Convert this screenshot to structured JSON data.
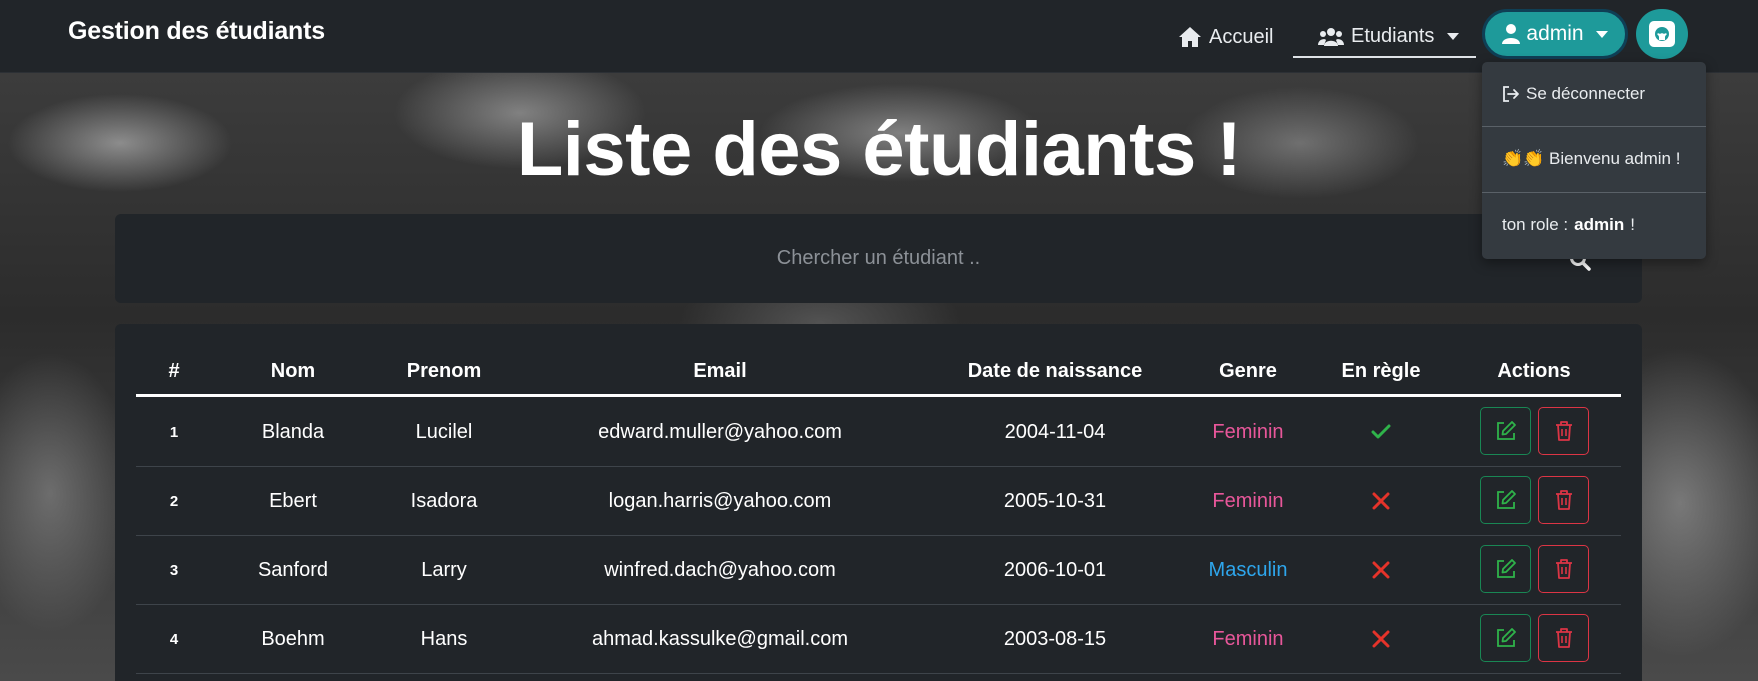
{
  "navbar": {
    "brand": "Gestion des étudiants",
    "home_label": "Accueil",
    "students_label": "Etudiants",
    "user_label": "admin"
  },
  "dropdown": {
    "logout_label": "Se déconnecter",
    "welcome_label": "👏👏 Bienvenu admin !",
    "role_prefix": "ton role :",
    "role_value": "admin",
    "role_suffix": "!"
  },
  "hero": {
    "title": "Liste des étudiants !"
  },
  "search": {
    "placeholder": "Chercher un étudiant .."
  },
  "table": {
    "headers": {
      "index": "#",
      "nom": "Nom",
      "prenom": "Prenom",
      "email": "Email",
      "date": "Date de naissance",
      "genre": "Genre",
      "regle": "En règle",
      "actions": "Actions"
    },
    "rows": [
      {
        "index": "1",
        "nom": "Blanda",
        "prenom": "Lucilel",
        "email": "edward.muller@yahoo.com",
        "date": "2004-11-04",
        "genre": "Feminin",
        "en_regle": "true"
      },
      {
        "index": "2",
        "nom": "Ebert",
        "prenom": "Isadora",
        "email": "logan.harris@yahoo.com",
        "date": "2005-10-31",
        "genre": "Feminin",
        "en_regle": "false"
      },
      {
        "index": "3",
        "nom": "Sanford",
        "prenom": "Larry",
        "email": "winfred.dach@yahoo.com",
        "date": "2006-10-01",
        "genre": "Masculin",
        "en_regle": "false"
      },
      {
        "index": "4",
        "nom": "Boehm",
        "prenom": "Hans",
        "email": "ahmad.kassulke@gmail.com",
        "date": "2003-08-15",
        "genre": "Feminin",
        "en_regle": "false"
      }
    ]
  },
  "colors": {
    "accent": "#1e9a9a",
    "feminin": "#e8579a",
    "masculin": "#2ea6ec",
    "check": "#2fb34a",
    "cross": "#e5332a"
  },
  "icons": {
    "home": "home-icon",
    "students": "users-icon",
    "user": "user-icon",
    "github": "github-icon",
    "logout": "logout-icon",
    "search": "search-icon",
    "edit": "edit-icon",
    "delete": "trash-icon",
    "check": "check-icon",
    "cross": "cross-icon"
  }
}
